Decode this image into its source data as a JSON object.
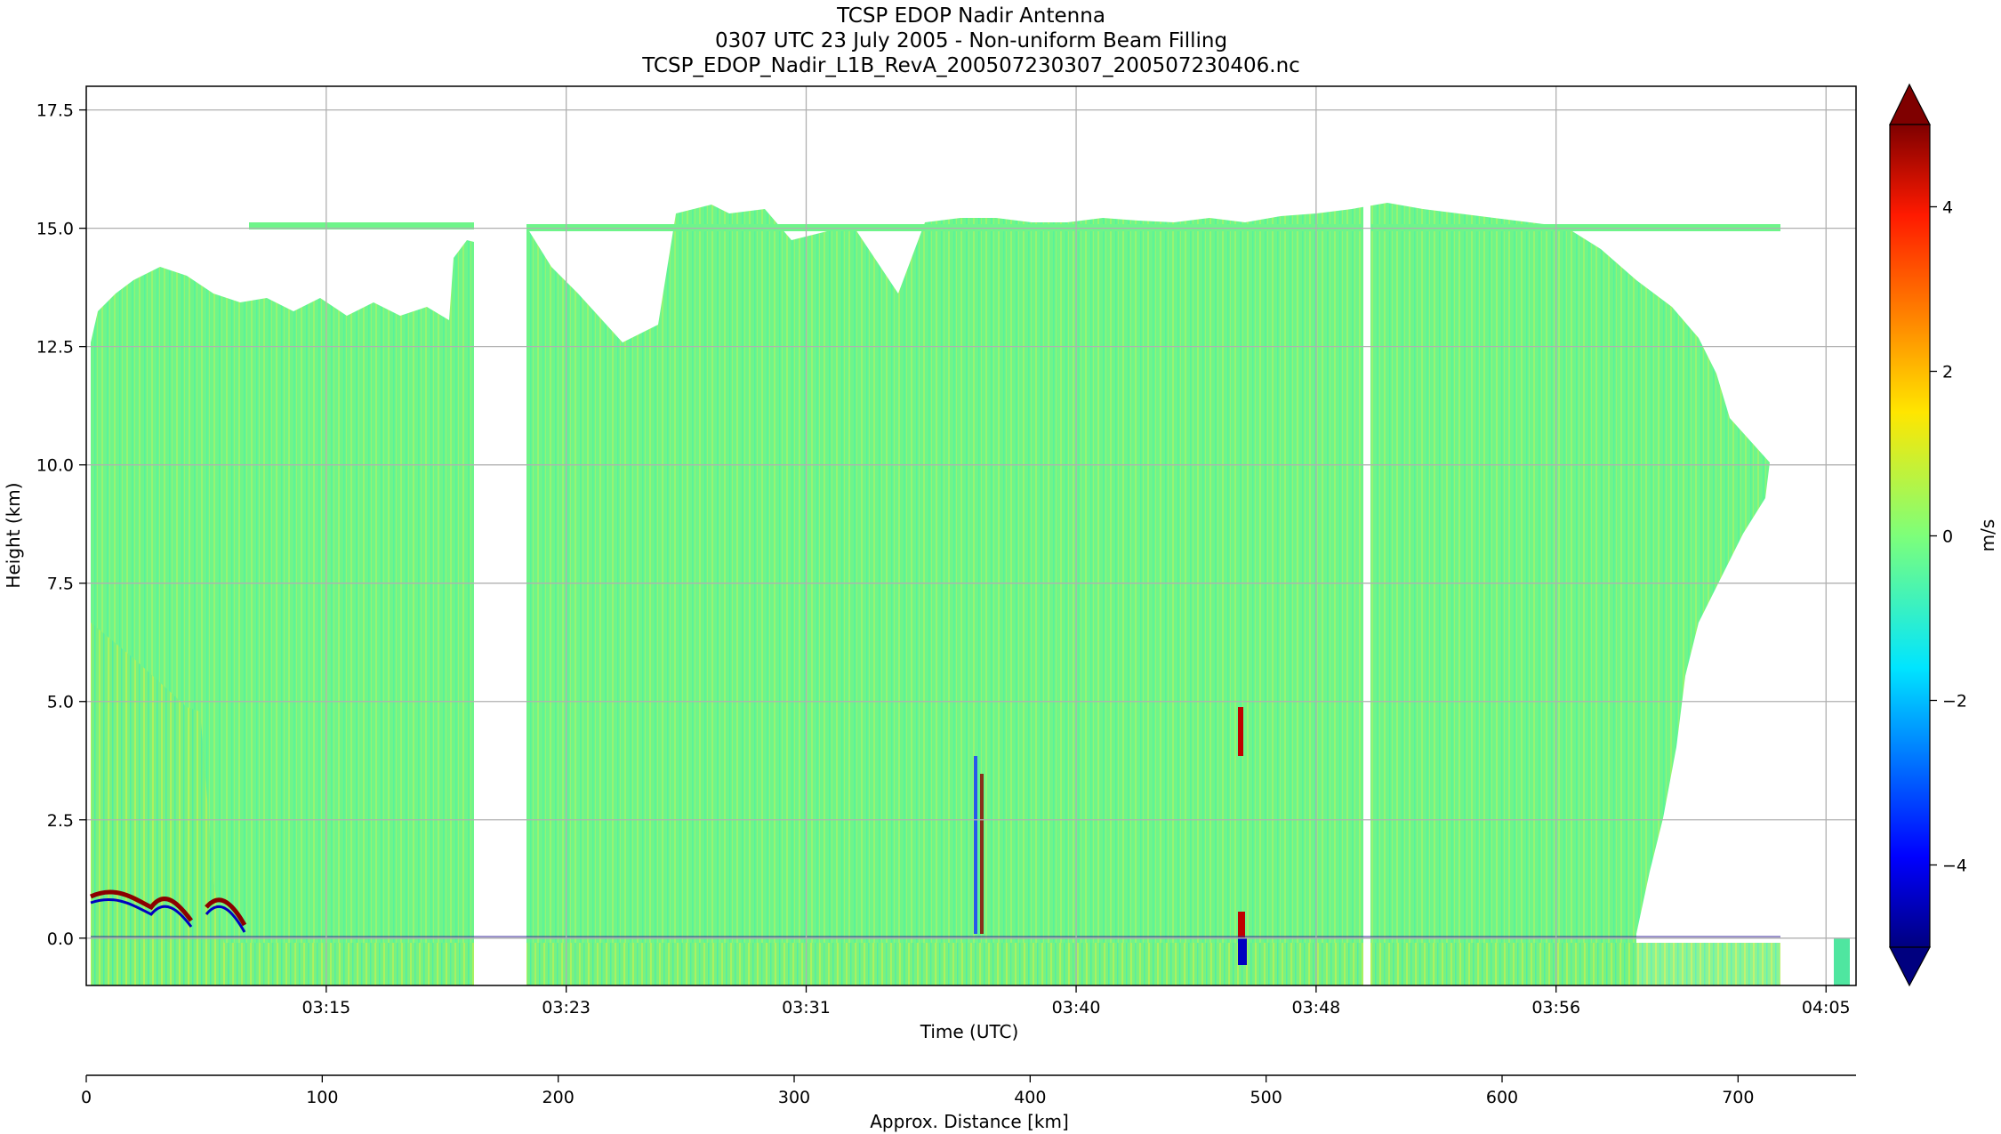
{
  "chart_data": {
    "type": "heatmap",
    "title_lines": [
      "TCSP EDOP Nadir Antenna",
      "0307 UTC 23 July 2005 - Non-uniform Beam Filling",
      "TCSP_EDOP_Nadir_L1B_RevA_200507230307_200507230406.nc"
    ],
    "xlabel": "Time (UTC)",
    "ylabel": "Height (km)",
    "x_ticks": [
      "03:15",
      "03:23",
      "03:31",
      "03:40",
      "03:48",
      "03:56",
      "04:05"
    ],
    "x_tick_minutes": [
      8.0,
      16.0,
      24.0,
      33.0,
      41.0,
      49.0,
      58.0
    ],
    "xlim_minutes": [
      0,
      59
    ],
    "ylim": [
      -1.0,
      18.0
    ],
    "y_ticks": [
      "0.0",
      "2.5",
      "5.0",
      "7.5",
      "10.0",
      "12.5",
      "15.0",
      "17.5"
    ],
    "y_tick_values": [
      0.0,
      2.5,
      5.0,
      7.5,
      10.0,
      12.5,
      15.0,
      17.5
    ],
    "grid": true,
    "secondary_axis": {
      "label": "Approx. Distance [km]",
      "ticks": [
        "0",
        "100",
        "200",
        "300",
        "400",
        "500",
        "600",
        "700"
      ],
      "tick_values": [
        0,
        100,
        200,
        300,
        400,
        500,
        600,
        700
      ],
      "xlim": [
        0,
        750
      ]
    },
    "colorbar": {
      "label": "m/s",
      "ticks": [
        "4",
        "2",
        "0",
        "−2",
        "−4"
      ],
      "tick_values": [
        4,
        2,
        0,
        -2,
        -4
      ],
      "range": [
        -5,
        5
      ],
      "colormap": "jet",
      "extend": "both"
    },
    "data_gaps_minutes": [
      [
        13.0,
        14.7
      ],
      [
        42.9,
        43.1
      ],
      [
        55.3,
        56.0
      ]
    ],
    "melting_layer_km": 4.8,
    "dominant_value_ms": 0.0,
    "notes": [
      "Echo top varies from ~12.5 to ~15.5 km; cirrus layer near 15 km",
      "Strong up/down couplets near surface at start and around 03:46"
    ]
  }
}
